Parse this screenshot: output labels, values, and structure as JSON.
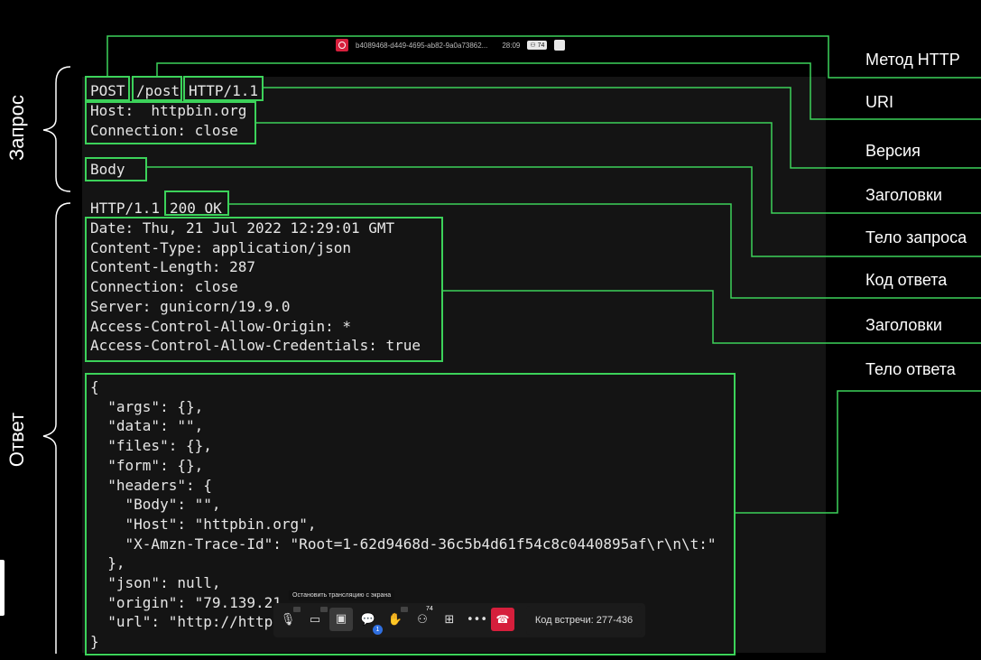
{
  "side_labels": {
    "request": "Запрос",
    "response": "Ответ"
  },
  "right_labels": [
    "Метод HTTP",
    "URI",
    "Версия",
    "Заголовки",
    "Тело запроса",
    "Код ответа",
    "Заголовки",
    "Тело ответа"
  ],
  "request": {
    "method": "POST",
    "uri": "/post",
    "version": "HTTP/1.1",
    "headers": [
      "Host:  httpbin.org",
      "Connection: close"
    ],
    "body": "Body"
  },
  "response": {
    "version": "HTTP/1.1",
    "status": "200 OK",
    "headers": [
      "Date: Thu, 21 Jul 2022 12:29:01 GMT",
      "Content-Type: application/json",
      "Content-Length: 287",
      "Connection: close",
      "Server: gunicorn/19.9.0",
      "Access-Control-Allow-Origin: *",
      "Access-Control-Allow-Credentials: true"
    ],
    "body": [
      "{",
      "  \"args\": {},",
      "  \"data\": \"\",",
      "  \"files\": {},",
      "  \"form\": {},",
      "  \"headers\": {",
      "    \"Body\": \"\",",
      "    \"Host\": \"httpbin.org\",",
      "    \"X-Amzn-Trace-Id\": \"Root=1-62d9468d-36c5b4d61f54c8c0440895af\\r\\n\\t:\"",
      "  },",
      "  \"json\": null,",
      "  \"origin\": \"79.139.21",
      "  \"url\": \"http://http",
      "}"
    ]
  },
  "meeting": {
    "meeting_id": "b4089468-d449-4695-ab82-9a0a73862...",
    "timer": "28:09",
    "participants": "74",
    "tooltip": "Остановить трансляцию с экрана",
    "chat_badge": "1",
    "participants_badge": "74",
    "meeting_code": "Код встречи: 277-436"
  },
  "colors": {
    "accent": "#3cd25a",
    "background": "#000000",
    "terminal": "#141414",
    "hangup": "#d61f3c"
  }
}
